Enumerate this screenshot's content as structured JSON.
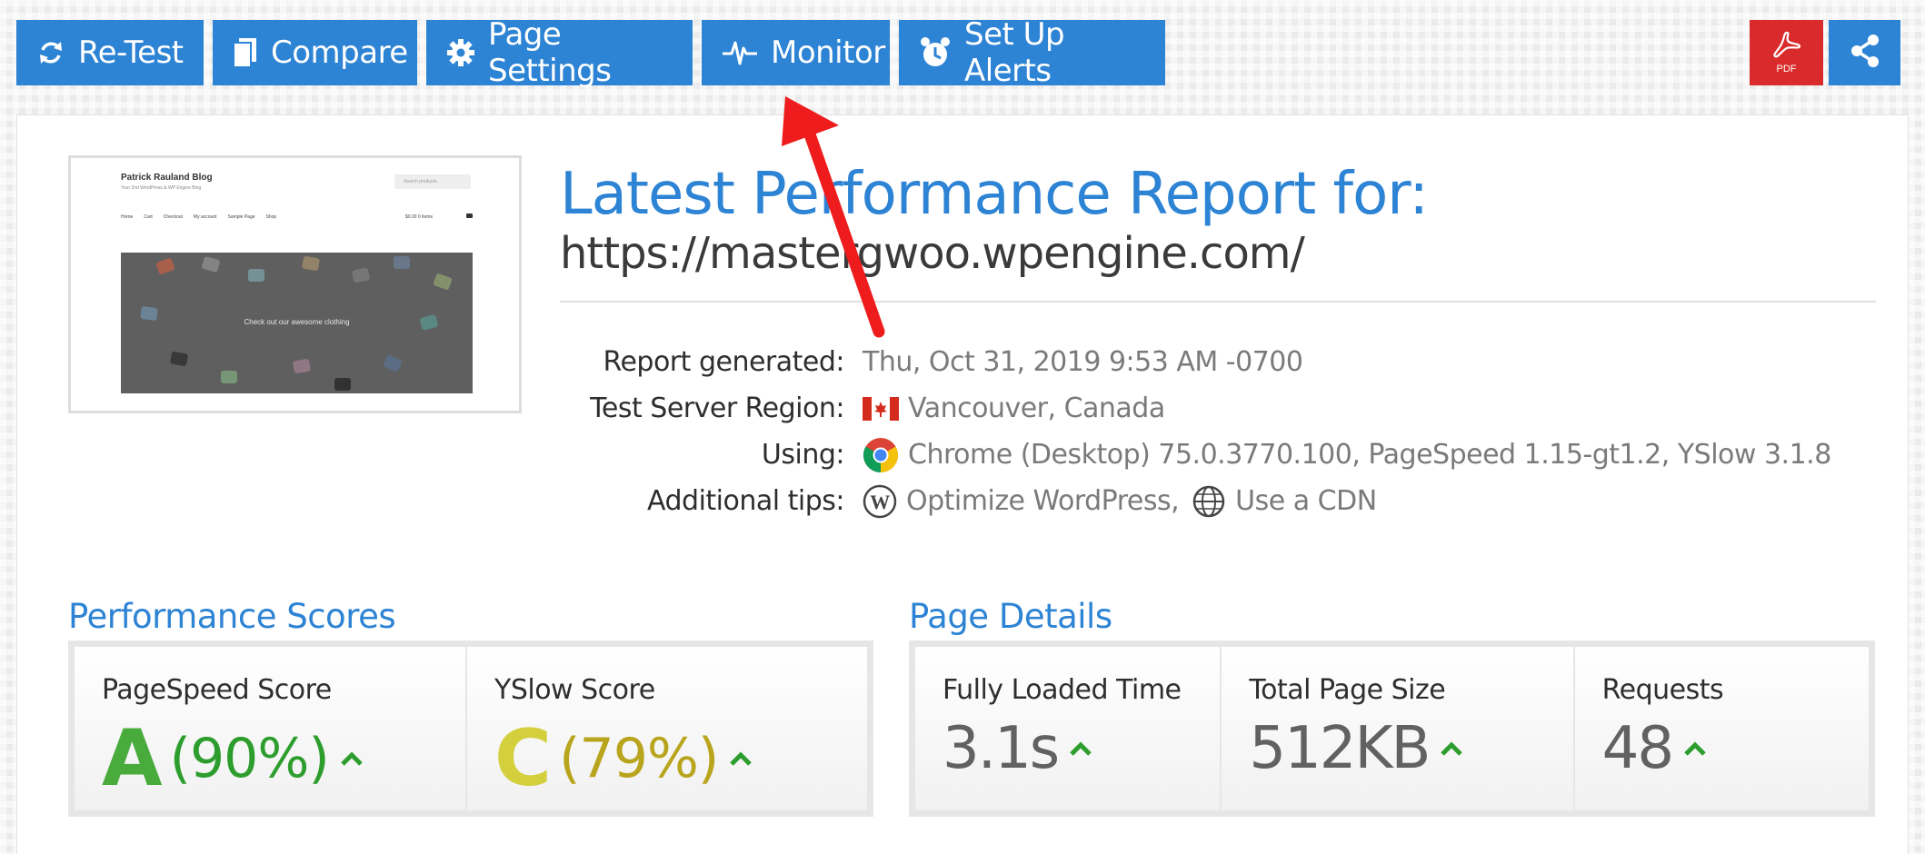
{
  "toolbar": {
    "retest": "Re-Test",
    "compare": "Compare",
    "page_settings": "Page Settings",
    "monitor": "Monitor",
    "alerts": "Set Up Alerts",
    "pdf": "PDF"
  },
  "thumbnail": {
    "site_title": "Patrick Rauland Blog",
    "tagline": "Your 2nd WordPress & WP Engine Blog",
    "search_placeholder": "Search products…",
    "nav": [
      "Home",
      "Cart",
      "Checkout",
      "My account",
      "Sample Page",
      "Shop"
    ],
    "cart": "$0.00  0 items",
    "hero_text": "Check out our awesome clothing"
  },
  "report": {
    "heading": "Latest Performance Report for:",
    "url": "https://mastergwoo.wpengine.com/"
  },
  "info": {
    "generated_label": "Report generated:",
    "generated_value": "Thu, Oct 31, 2019 9:53 AM -0700",
    "region_label": "Test Server Region:",
    "region_value": "Vancouver, Canada",
    "using_label": "Using:",
    "using_value": "Chrome (Desktop) 75.0.3770.100, PageSpeed 1.15-gt1.2, YSlow 3.1.8",
    "tips_label": "Additional tips:",
    "tip_wordpress": "Optimize WordPress,",
    "tip_cdn": "Use a CDN"
  },
  "performance": {
    "title": "Performance Scores",
    "pagespeed_label": "PageSpeed Score",
    "pagespeed_grade": "A",
    "pagespeed_pct": "(90%)",
    "yslow_label": "YSlow Score",
    "yslow_grade": "C",
    "yslow_pct": "(79%)"
  },
  "details": {
    "title": "Page Details",
    "loaded_label": "Fully Loaded Time",
    "loaded_value": "3.1s",
    "size_label": "Total Page Size",
    "size_value": "512KB",
    "requests_label": "Requests",
    "requests_value": "48"
  },
  "colors": {
    "brand_blue": "#2d83d4",
    "pdf_red": "#d92b2b",
    "grade_a": "#4aab3d",
    "grade_c": "#d4cf3c",
    "annotation_arrow": "#ee1c1c"
  },
  "icons": {
    "retest": "refresh-icon",
    "compare": "copy-icon",
    "page_settings": "gear-icon",
    "monitor": "pulse-icon",
    "alerts": "alarm-clock-icon",
    "pdf": "pdf-icon",
    "share": "share-icon"
  }
}
